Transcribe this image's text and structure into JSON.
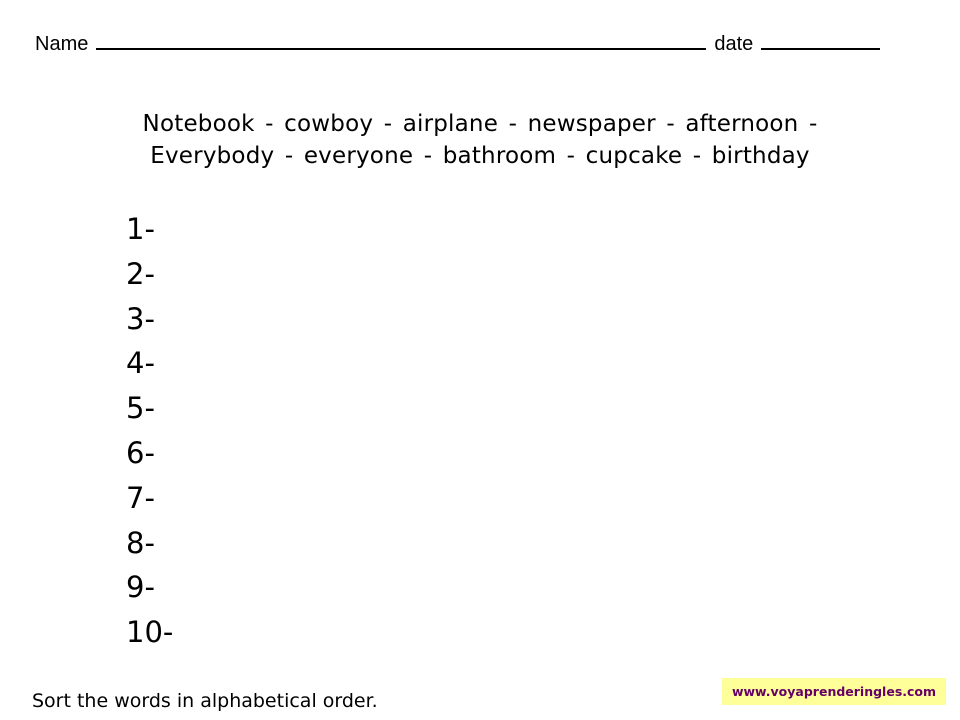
{
  "header": {
    "name_label": "Name",
    "date_label": "date"
  },
  "word_bank": {
    "line1": "Notebook - cowboy - airplane - newspaper - afternoon -",
    "line2": "Everybody - everyone - bathroom - cupcake - birthday",
    "words": [
      "Notebook",
      "cowboy",
      "airplane",
      "newspaper",
      "afternoon",
      "Everybody",
      "everyone",
      "bathroom",
      "cupcake",
      "birthday"
    ]
  },
  "answers": [
    {
      "label": "1-"
    },
    {
      "label": "2-"
    },
    {
      "label": "3-"
    },
    {
      "label": "4-"
    },
    {
      "label": "5-"
    },
    {
      "label": "6-"
    },
    {
      "label": "7-"
    },
    {
      "label": "8-"
    },
    {
      "label": "9-"
    },
    {
      "label": "10-"
    }
  ],
  "footer": {
    "instruction": "Sort the words in alphabetical order.",
    "website": "www.voyaprenderingles.com",
    "badge_bg": "#ffff99",
    "badge_text_color": "#660066"
  }
}
